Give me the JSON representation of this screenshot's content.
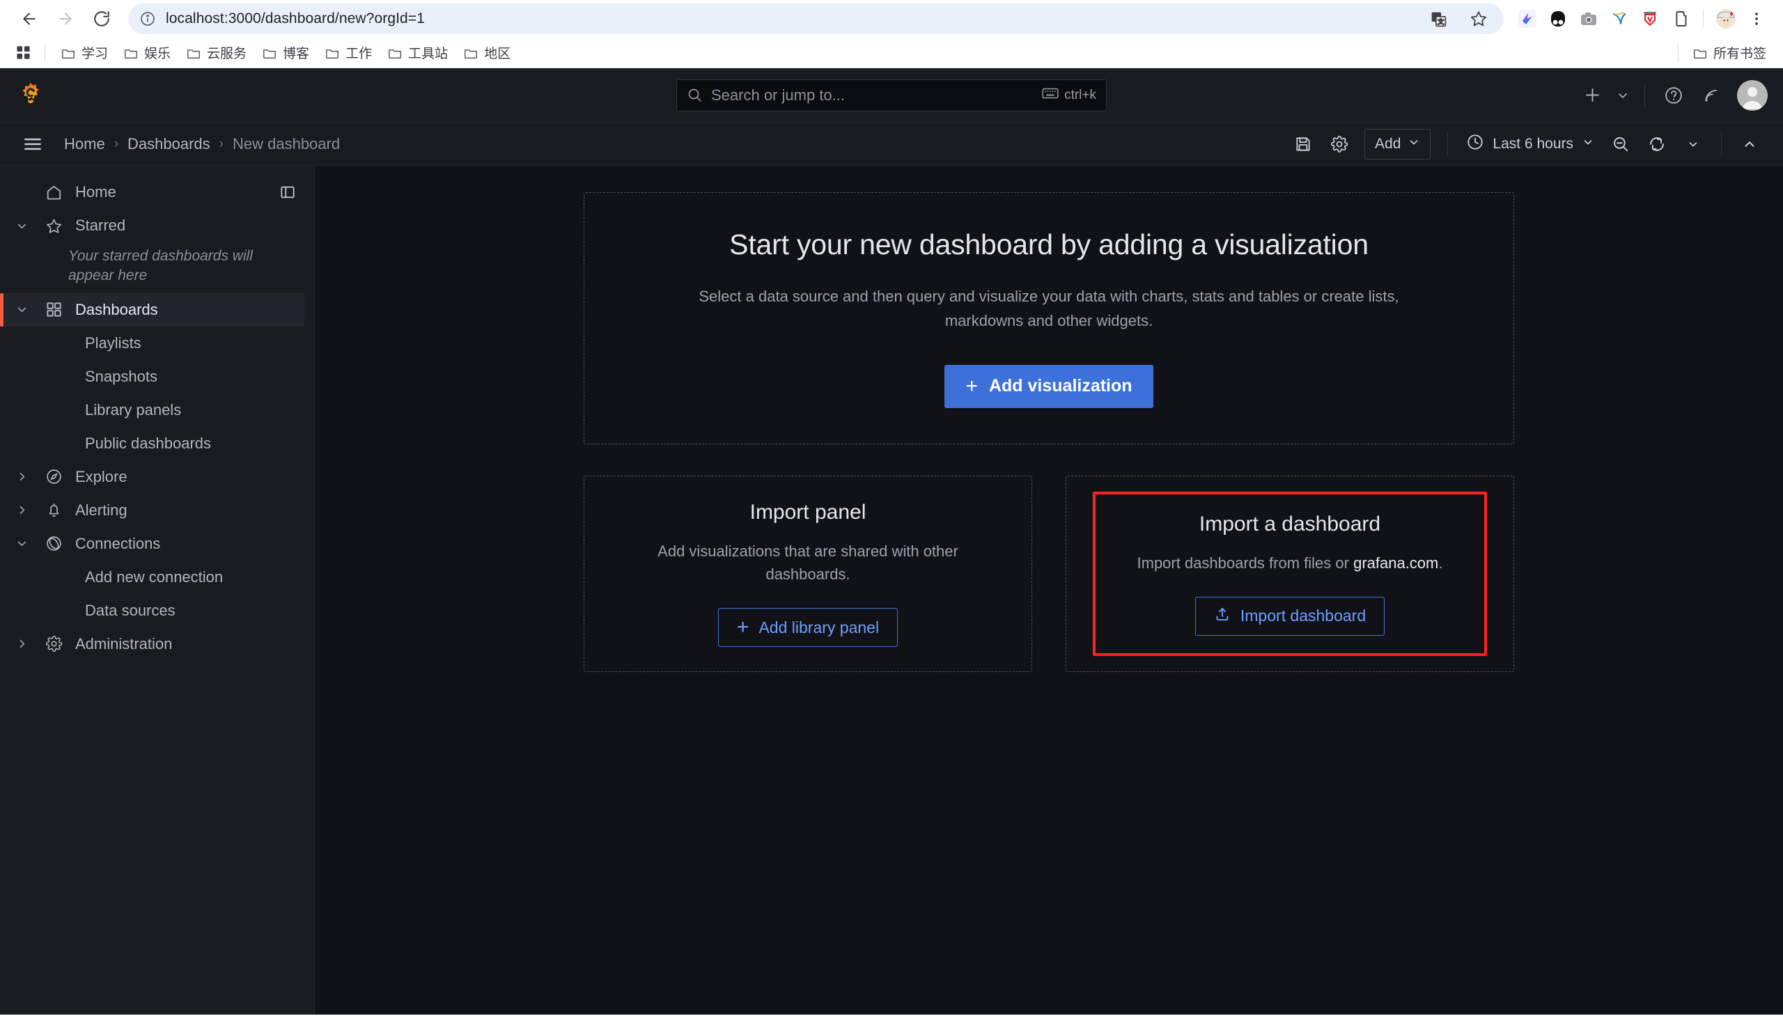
{
  "browser": {
    "url": "localhost:3000/dashboard/new?orgId=1",
    "back_icon": "back-arrow-icon",
    "forward_icon": "forward-arrow-icon",
    "reload_icon": "reload-icon",
    "site_info_icon": "site-info-icon",
    "translate_icon": "translate-icon",
    "bookmark_star_icon": "bookmark-star-icon",
    "menu_icon": "browser-menu-icon",
    "extensions": [
      "extension-blue-bird-icon",
      "extension-black-oval-icon",
      "extension-camera-icon",
      "extension-y-icon",
      "extension-red-shield-icon",
      "extension-puzzle-icon"
    ],
    "profile_icon": "profile-avatar-icon",
    "bookmarks": [
      {
        "label": "学习"
      },
      {
        "label": "娱乐"
      },
      {
        "label": "云服务"
      },
      {
        "label": "博客"
      },
      {
        "label": "工作"
      },
      {
        "label": "工具站"
      },
      {
        "label": "地区"
      }
    ],
    "all_bookmarks_label": "所有书签",
    "apps_icon": "apps-grid-icon"
  },
  "topbar": {
    "logo_icon": "grafana-logo-icon",
    "search": {
      "placeholder": "Search or jump to...",
      "shortcut": "ctrl+k",
      "search_icon": "search-icon",
      "keyboard_icon": "keyboard-icon"
    },
    "actions": {
      "add_icon": "plus-icon",
      "add_chevron_icon": "chevron-down-icon",
      "help_icon": "help-circle-icon",
      "news_icon": "rss-news-icon",
      "avatar_icon": "user-avatar-icon"
    }
  },
  "subbar": {
    "menu_icon": "hamburger-menu-icon",
    "breadcrumb": [
      {
        "label": "Home"
      },
      {
        "label": "Dashboards"
      },
      {
        "label": "New dashboard"
      }
    ],
    "breadcrumb_separator": "›",
    "save_icon": "save-disk-icon",
    "settings_icon": "gear-icon",
    "add_label": "Add",
    "add_chevron_icon": "chevron-down-icon",
    "time_icon": "clock-icon",
    "time_range": "Last 6 hours",
    "time_chevron_icon": "chevron-down-icon",
    "zoom_out_icon": "zoom-out-icon",
    "refresh_icon": "refresh-icon",
    "refresh_chevron_icon": "chevron-down-icon",
    "collapse_icon": "chevron-up-icon"
  },
  "sidebar": {
    "dock_icon": "dock-sidebar-icon",
    "items": [
      {
        "label": "Home",
        "icon": "home-icon",
        "expandable": false,
        "active": false
      },
      {
        "label": "Starred",
        "icon": "star-icon",
        "expandable": true,
        "expanded": true,
        "active": false
      },
      {
        "label": "Dashboards",
        "icon": "dashboards-grid-icon",
        "expandable": true,
        "expanded": true,
        "active": true
      },
      {
        "label": "Explore",
        "icon": "compass-icon",
        "expandable": true,
        "expanded": false,
        "active": false
      },
      {
        "label": "Alerting",
        "icon": "bell-icon",
        "expandable": true,
        "expanded": false,
        "active": false
      },
      {
        "label": "Connections",
        "icon": "connections-icon",
        "expandable": true,
        "expanded": true,
        "active": false
      },
      {
        "label": "Administration",
        "icon": "gear-icon",
        "expandable": true,
        "expanded": false,
        "active": false
      }
    ],
    "starred_empty_text": "Your starred dashboards will appear here",
    "dashboard_children": [
      "Playlists",
      "Snapshots",
      "Library panels",
      "Public dashboards"
    ],
    "connections_children": [
      "Add new connection",
      "Data sources"
    ]
  },
  "main": {
    "hero": {
      "title": "Start your new dashboard by adding a visualization",
      "description": "Select a data source and then query and visualize your data with charts, stats and tables or create lists, markdowns and other widgets.",
      "button_label": "Add visualization",
      "button_icon": "plus-icon",
      "button_color": "#3d71d9"
    },
    "import_panel": {
      "title": "Import panel",
      "description": "Add visualizations that are shared with other dashboards.",
      "button_label": "Add library panel",
      "button_icon": "plus-icon"
    },
    "import_dashboard": {
      "title": "Import a dashboard",
      "description_prefix": "Import dashboards from files or ",
      "description_link": "grafana.com",
      "description_suffix": ".",
      "button_label": "Import dashboard",
      "button_icon": "upload-icon",
      "highlight_color": "#ff2020"
    }
  }
}
